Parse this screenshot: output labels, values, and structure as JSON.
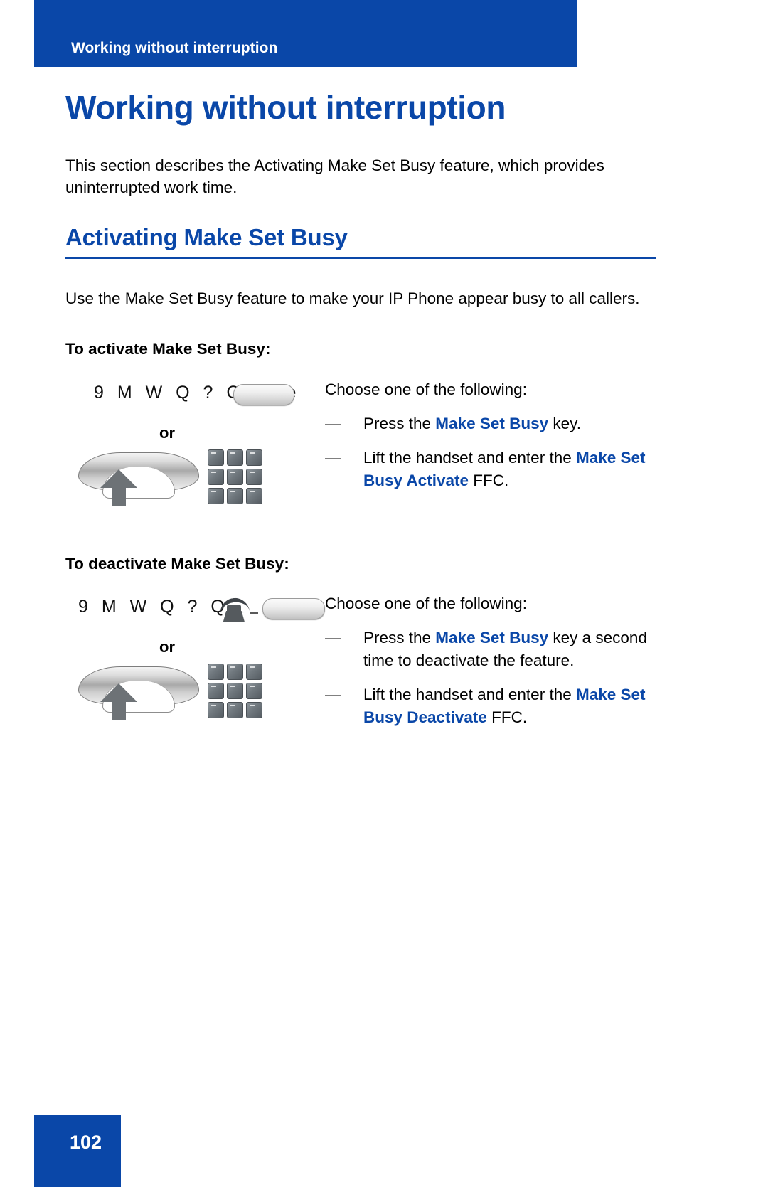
{
  "colors": {
    "brand_blue": "#0a47a8",
    "text_black": "#000000",
    "page_white": "#ffffff"
  },
  "running_header": {
    "text": "Working without interruption"
  },
  "page_title": "Working without interruption",
  "intro_paragraph": "This section describes the Activating Make Set Busy feature, which provides uninterrupted work time.",
  "section": {
    "heading": "Activating Make Set Busy",
    "paragraph": "Use the Make Set Busy feature to make your IP Phone appear busy to all callers."
  },
  "activate": {
    "sub_head": "To activate Make Set Busy:",
    "icon_glyphs": "9 M W Q ? C",
    "icon_trailing": "e",
    "or_label": "or",
    "lead_line": "Choose one of the following:",
    "bullets": [
      {
        "dash": "—",
        "parts": [
          {
            "text": "Press the ",
            "style": "plain"
          },
          {
            "text": "Make Set Busy",
            "style": "blue"
          },
          {
            "text": " key.",
            "style": "plain"
          }
        ]
      },
      {
        "dash": "—",
        "parts": [
          {
            "text": "Lift the handset and enter the ",
            "style": "plain"
          },
          {
            "text": "Make Set Busy Activate",
            "style": "blue"
          },
          {
            "text": " FFC.",
            "style": "plain"
          }
        ]
      }
    ]
  },
  "deactivate": {
    "sub_head": "To deactivate Make Set Busy:",
    "icon_glyphs": "9 M W Q ? Q",
    "or_label": "or",
    "lead_line": "Choose one of the following:",
    "bullets": [
      {
        "dash": "—",
        "parts": [
          {
            "text": "Press the ",
            "style": "plain"
          },
          {
            "text": "Make Set Busy",
            "style": "blue"
          },
          {
            "text": " key a second time to deactivate the feature.",
            "style": "plain"
          }
        ]
      },
      {
        "dash": "—",
        "parts": [
          {
            "text": "Lift the handset and enter the ",
            "style": "plain"
          },
          {
            "text": "Make Set Busy Deactivate",
            "style": "blue"
          },
          {
            "text": " FFC.",
            "style": "plain"
          }
        ]
      }
    ]
  },
  "footer": {
    "page_number": "102"
  }
}
